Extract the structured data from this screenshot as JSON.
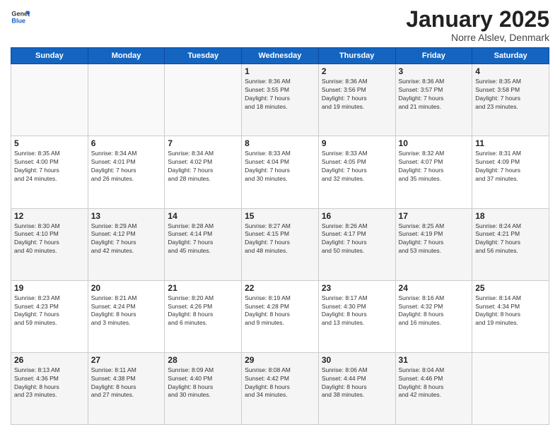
{
  "header": {
    "logo_general": "General",
    "logo_blue": "Blue",
    "title": "January 2025",
    "subtitle": "Norre Alslev, Denmark"
  },
  "days_of_week": [
    "Sunday",
    "Monday",
    "Tuesday",
    "Wednesday",
    "Thursday",
    "Friday",
    "Saturday"
  ],
  "weeks": [
    [
      {
        "day": "",
        "info": ""
      },
      {
        "day": "",
        "info": ""
      },
      {
        "day": "",
        "info": ""
      },
      {
        "day": "1",
        "info": "Sunrise: 8:36 AM\nSunset: 3:55 PM\nDaylight: 7 hours\nand 18 minutes."
      },
      {
        "day": "2",
        "info": "Sunrise: 8:36 AM\nSunset: 3:56 PM\nDaylight: 7 hours\nand 19 minutes."
      },
      {
        "day": "3",
        "info": "Sunrise: 8:36 AM\nSunset: 3:57 PM\nDaylight: 7 hours\nand 21 minutes."
      },
      {
        "day": "4",
        "info": "Sunrise: 8:35 AM\nSunset: 3:58 PM\nDaylight: 7 hours\nand 23 minutes."
      }
    ],
    [
      {
        "day": "5",
        "info": "Sunrise: 8:35 AM\nSunset: 4:00 PM\nDaylight: 7 hours\nand 24 minutes."
      },
      {
        "day": "6",
        "info": "Sunrise: 8:34 AM\nSunset: 4:01 PM\nDaylight: 7 hours\nand 26 minutes."
      },
      {
        "day": "7",
        "info": "Sunrise: 8:34 AM\nSunset: 4:02 PM\nDaylight: 7 hours\nand 28 minutes."
      },
      {
        "day": "8",
        "info": "Sunrise: 8:33 AM\nSunset: 4:04 PM\nDaylight: 7 hours\nand 30 minutes."
      },
      {
        "day": "9",
        "info": "Sunrise: 8:33 AM\nSunset: 4:05 PM\nDaylight: 7 hours\nand 32 minutes."
      },
      {
        "day": "10",
        "info": "Sunrise: 8:32 AM\nSunset: 4:07 PM\nDaylight: 7 hours\nand 35 minutes."
      },
      {
        "day": "11",
        "info": "Sunrise: 8:31 AM\nSunset: 4:09 PM\nDaylight: 7 hours\nand 37 minutes."
      }
    ],
    [
      {
        "day": "12",
        "info": "Sunrise: 8:30 AM\nSunset: 4:10 PM\nDaylight: 7 hours\nand 40 minutes."
      },
      {
        "day": "13",
        "info": "Sunrise: 8:29 AM\nSunset: 4:12 PM\nDaylight: 7 hours\nand 42 minutes."
      },
      {
        "day": "14",
        "info": "Sunrise: 8:28 AM\nSunset: 4:14 PM\nDaylight: 7 hours\nand 45 minutes."
      },
      {
        "day": "15",
        "info": "Sunrise: 8:27 AM\nSunset: 4:15 PM\nDaylight: 7 hours\nand 48 minutes."
      },
      {
        "day": "16",
        "info": "Sunrise: 8:26 AM\nSunset: 4:17 PM\nDaylight: 7 hours\nand 50 minutes."
      },
      {
        "day": "17",
        "info": "Sunrise: 8:25 AM\nSunset: 4:19 PM\nDaylight: 7 hours\nand 53 minutes."
      },
      {
        "day": "18",
        "info": "Sunrise: 8:24 AM\nSunset: 4:21 PM\nDaylight: 7 hours\nand 56 minutes."
      }
    ],
    [
      {
        "day": "19",
        "info": "Sunrise: 8:23 AM\nSunset: 4:23 PM\nDaylight: 7 hours\nand 59 minutes."
      },
      {
        "day": "20",
        "info": "Sunrise: 8:21 AM\nSunset: 4:24 PM\nDaylight: 8 hours\nand 3 minutes."
      },
      {
        "day": "21",
        "info": "Sunrise: 8:20 AM\nSunset: 4:26 PM\nDaylight: 8 hours\nand 6 minutes."
      },
      {
        "day": "22",
        "info": "Sunrise: 8:19 AM\nSunset: 4:28 PM\nDaylight: 8 hours\nand 9 minutes."
      },
      {
        "day": "23",
        "info": "Sunrise: 8:17 AM\nSunset: 4:30 PM\nDaylight: 8 hours\nand 13 minutes."
      },
      {
        "day": "24",
        "info": "Sunrise: 8:16 AM\nSunset: 4:32 PM\nDaylight: 8 hours\nand 16 minutes."
      },
      {
        "day": "25",
        "info": "Sunrise: 8:14 AM\nSunset: 4:34 PM\nDaylight: 8 hours\nand 19 minutes."
      }
    ],
    [
      {
        "day": "26",
        "info": "Sunrise: 8:13 AM\nSunset: 4:36 PM\nDaylight: 8 hours\nand 23 minutes."
      },
      {
        "day": "27",
        "info": "Sunrise: 8:11 AM\nSunset: 4:38 PM\nDaylight: 8 hours\nand 27 minutes."
      },
      {
        "day": "28",
        "info": "Sunrise: 8:09 AM\nSunset: 4:40 PM\nDaylight: 8 hours\nand 30 minutes."
      },
      {
        "day": "29",
        "info": "Sunrise: 8:08 AM\nSunset: 4:42 PM\nDaylight: 8 hours\nand 34 minutes."
      },
      {
        "day": "30",
        "info": "Sunrise: 8:06 AM\nSunset: 4:44 PM\nDaylight: 8 hours\nand 38 minutes."
      },
      {
        "day": "31",
        "info": "Sunrise: 8:04 AM\nSunset: 4:46 PM\nDaylight: 8 hours\nand 42 minutes."
      },
      {
        "day": "",
        "info": ""
      }
    ]
  ]
}
